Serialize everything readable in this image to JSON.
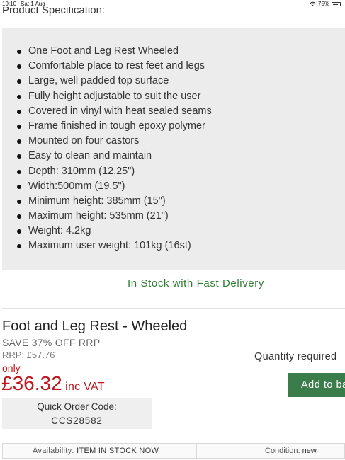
{
  "status_bar": {
    "time": "19:10",
    "date": "Sat 1 Aug",
    "battery": "75%",
    "battery_level": 0.75,
    "icons": [
      "wifi-icon",
      "battery-icon"
    ]
  },
  "spec": {
    "heading": "Product Specification:",
    "items": [
      "One Foot and Leg Rest Wheeled",
      "Comfortable place to rest feet and legs",
      "Large, well padded top surface",
      "Fully height adjustable to suit the user",
      "Covered in vinyl with heat sealed seams",
      "Frame finished in tough epoxy polymer",
      "Mounted on four castors",
      "Easy to clean and maintain",
      "Depth: 310mm (12.25\")",
      "Width:500mm (19.5\")",
      "Minimum height: 385mm (15\")",
      "Maximum height: 535mm (21\")",
      "Weight: 4.2kg",
      "Maximum user weight: 101kg (16st)"
    ]
  },
  "stock_banner": "In Stock with Fast Delivery",
  "product": {
    "title": "Foot and Leg Rest - Wheeled",
    "save": "SAVE 37% OFF RRP",
    "rrp_label": "RRP:",
    "rrp_value": "£57.76",
    "only": "only",
    "price": "£36.32",
    "vat": "inc VAT",
    "quick_order_label": "Quick Order Code:",
    "quick_order_code": "CCS28582",
    "quantity_label": "Quantity required",
    "add_button": "Add to basket"
  },
  "info_bar": {
    "availability_label": "Availability:",
    "availability_value": "ITEM IN STOCK NOW",
    "condition_label": "Condition:",
    "condition_value": "new"
  },
  "colors": {
    "accent_green": "#3a7d4a",
    "stock_text": "#2e7d32",
    "price_red": "#c0161d",
    "panel_grey": "#ececec"
  }
}
